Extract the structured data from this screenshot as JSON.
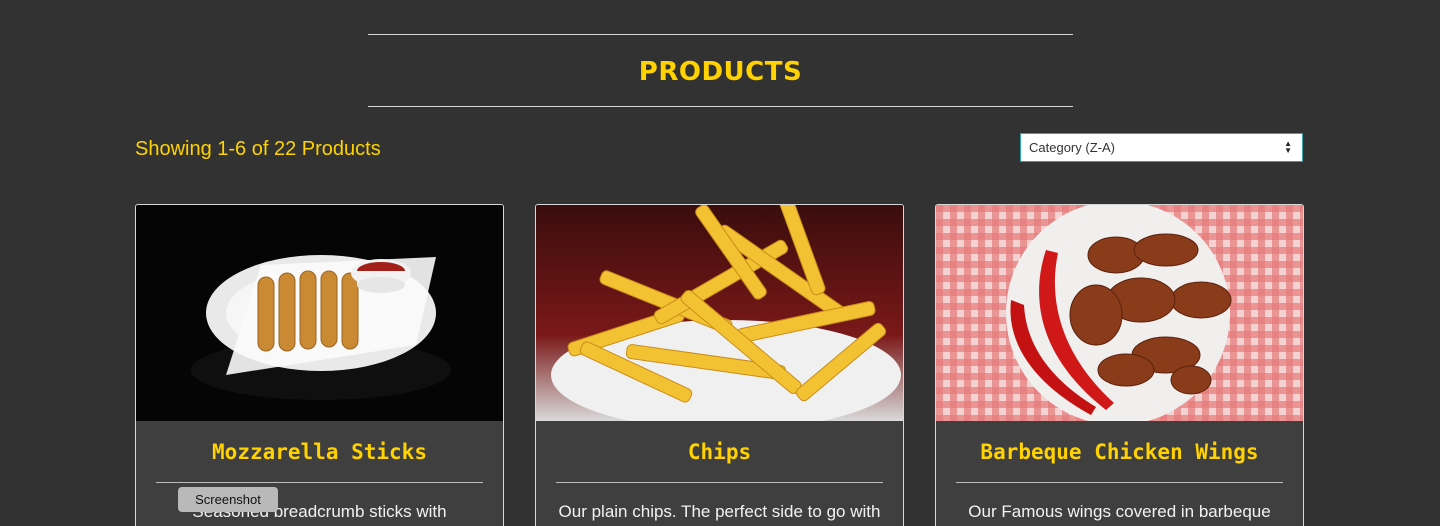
{
  "header": {
    "title": "PRODUCTS"
  },
  "toolbar": {
    "showing_text": "Showing 1-6 of 22 Products",
    "sort_selected": "Category (Z-A)"
  },
  "colors": {
    "background": "#323232",
    "accent_yellow": "#ffd200",
    "card_background": "#3f3f3f",
    "select_border": "#2aa6a6"
  },
  "products": [
    {
      "name": "Mozzarella Sticks",
      "description": "Seasoned breadcrumb sticks with",
      "image": "mozzarella-sticks-photo"
    },
    {
      "name": "Chips",
      "description": "Our plain chips. The perfect side to go with",
      "image": "chips-photo"
    },
    {
      "name": "Barbeque Chicken Wings",
      "description": "Our Famous wings covered in barbeque",
      "image": "chicken-wings-photo"
    }
  ],
  "tooltip": {
    "label": "Screenshot"
  }
}
